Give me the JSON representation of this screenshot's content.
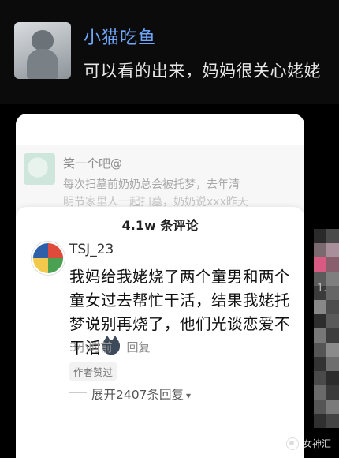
{
  "top": {
    "username": "小猫吃鱼",
    "message": "可以看的出来，妈妈很关心姥姥"
  },
  "background_comment": {
    "name": "笑一个吧@",
    "text_line1": "每次扫墓前奶奶总会被托梦，去年清",
    "text_line2": "明节家里人一起扫墓，奶奶说xxx昨天"
  },
  "sheet": {
    "comment_count": "4.1w 条评论",
    "comment": {
      "author": "TSJ_23",
      "body": "我妈给我姥烧了两个童男和两个童女过去帮忙干活，结果我姥托梦说别再烧了，他们光谈恋爱不干活",
      "time": "3小时前",
      "reply_label": "回复",
      "author_liked": "作者赞过",
      "expand_replies": "展开2407条回复"
    }
  },
  "side_text": "1.",
  "watermark": "女神汇",
  "icons": {
    "cat_emoji": "cat-face-icon",
    "chevron": "chevron-down-icon",
    "watermark_icon": "wechat-icon"
  }
}
